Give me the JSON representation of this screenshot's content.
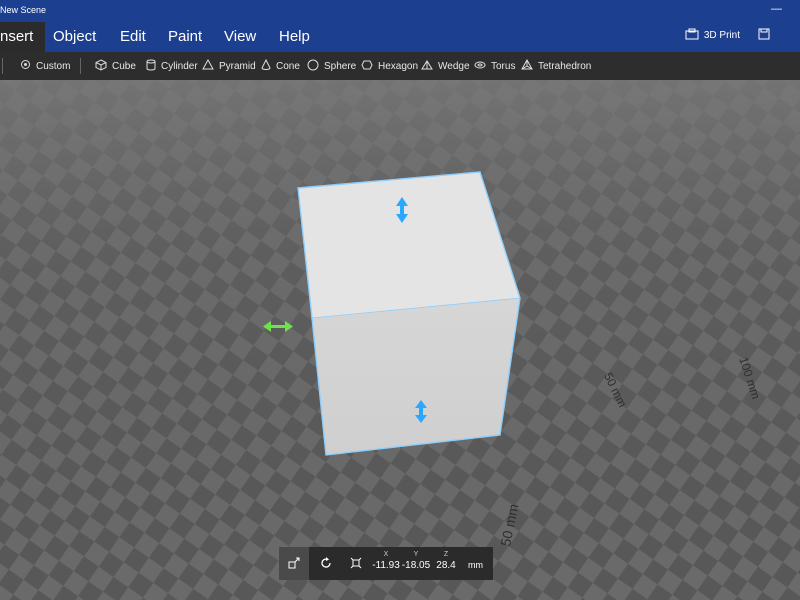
{
  "window": {
    "title": "New Scene"
  },
  "menu": {
    "active": "nsert",
    "items": [
      "Object",
      "Edit",
      "Paint",
      "View",
      "Help"
    ]
  },
  "header_tools": {
    "print_label": "3D Print"
  },
  "shapes": [
    "Custom",
    "Cube",
    "Cylinder",
    "Pyramid",
    "Cone",
    "Sphere",
    "Hexagon",
    "Wedge",
    "Torus",
    "Tetrahedron"
  ],
  "rulers": {
    "mid_right": "50 mm",
    "far_right": "100 mm",
    "front": "50 mm"
  },
  "transform": {
    "x_label": "X",
    "y_label": "Y",
    "z_label": "Z",
    "x_value": "-11.93",
    "y_value": "-18.05",
    "z_value": "28.4",
    "unit": "mm"
  },
  "colors": {
    "title_bar": "#1d3f8f",
    "selection": "#8ccfff",
    "gizmo_blue": "#2aa8ff",
    "gizmo_green": "#6ee24a"
  },
  "icons": [
    "minimize-icon",
    "3d-print-icon",
    "save-icon",
    "move-icon",
    "rotate-icon",
    "scale-icon"
  ]
}
